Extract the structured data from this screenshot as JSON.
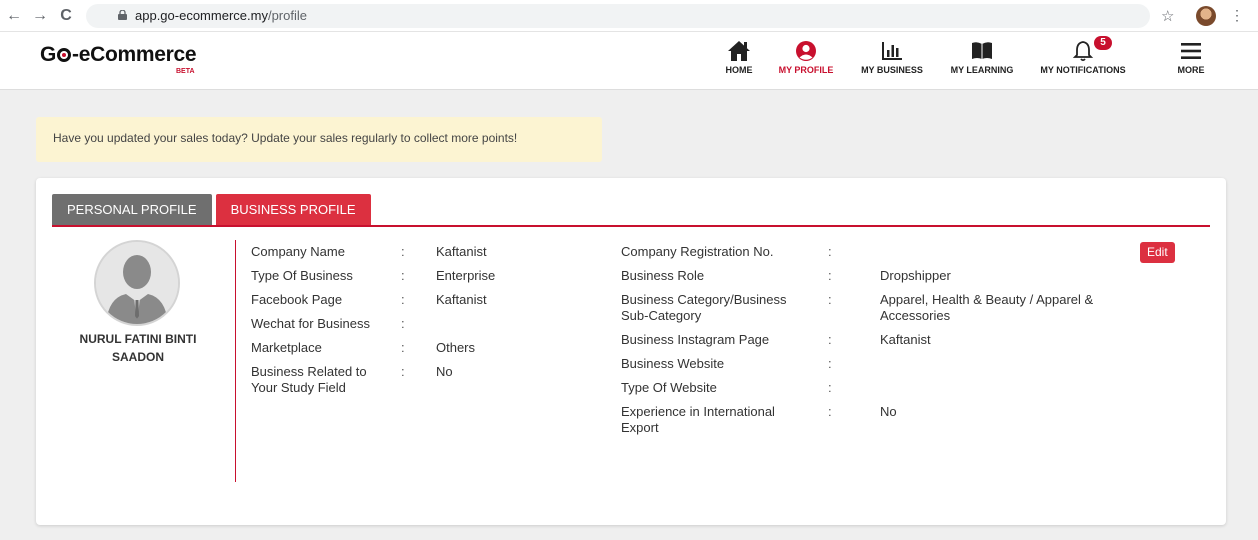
{
  "browser": {
    "back_icon": "←",
    "forward_icon": "→",
    "reload_icon": "C",
    "url_host": "app.go-ecommerce.my",
    "url_path": "/profile",
    "star_icon": "☆",
    "menu_icon": "⋮"
  },
  "brand": {
    "logo_g": "G",
    "logo_rest": "-eCommerce",
    "beta": "BETA",
    "accent_color": "#c8102e"
  },
  "nav": {
    "home": "HOME",
    "my_profile": "MY PROFILE",
    "my_business": "MY BUSINESS",
    "my_learning": "MY LEARNING",
    "my_notifications": "MY NOTIFICATIONS",
    "notification_count": "5",
    "more": "MORE"
  },
  "alert": {
    "message": "Have you updated your sales today? Update your sales regularly to collect more points!"
  },
  "tabs": {
    "personal": "PERSONAL PROFILE",
    "business": "BUSINESS PROFILE"
  },
  "profile": {
    "name": "NURUL FATINI BINTI SAADON"
  },
  "left_fields": [
    {
      "label": "Company Name",
      "sep": ":",
      "value": "Kaftanist"
    },
    {
      "label": "Type Of Business",
      "sep": ":",
      "value": "Enterprise"
    },
    {
      "label": "Facebook Page",
      "sep": ":",
      "value": "Kaftanist"
    },
    {
      "label": "Wechat for Business",
      "sep": ":",
      "value": ""
    },
    {
      "label": "Marketplace",
      "sep": ":",
      "value": "Others"
    },
    {
      "label": "Business Related to Your Study Field",
      "sep": ":",
      "value": "No"
    }
  ],
  "right_fields": [
    {
      "label": "Company Registration No.",
      "sep": ":",
      "value": ""
    },
    {
      "label": "Business Role",
      "sep": ":",
      "value": "Dropshipper"
    },
    {
      "label": "Business Category/Business Sub-Category",
      "sep": ":",
      "value": "Apparel, Health & Beauty / Apparel & Accessories"
    },
    {
      "label": "Business Instagram Page",
      "sep": ":",
      "value": "Kaftanist"
    },
    {
      "label": "Business Website",
      "sep": ":",
      "value": ""
    },
    {
      "label": "Type Of Website",
      "sep": ":",
      "value": ""
    },
    {
      "label": "Experience in International Export",
      "sep": ":",
      "value": "No"
    }
  ],
  "edit_label": "Edit"
}
